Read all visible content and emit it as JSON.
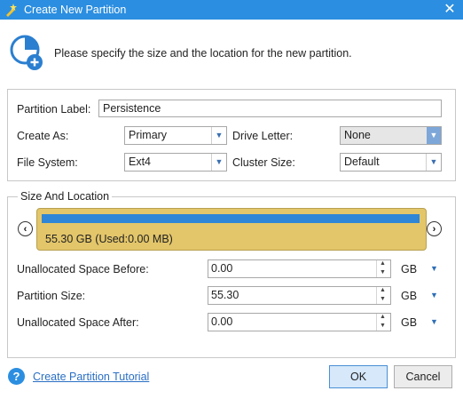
{
  "window": {
    "title": "Create New Partition",
    "close_glyph": "✕"
  },
  "header": {
    "instruction": "Please specify the size and the location for the new partition."
  },
  "form": {
    "partition_label": {
      "label": "Partition Label:",
      "value": "Persistence"
    },
    "create_as": {
      "label": "Create As:",
      "value": "Primary"
    },
    "drive_letter": {
      "label": "Drive Letter:",
      "value": "None"
    },
    "file_system": {
      "label": "File System:",
      "value": "Ext4"
    },
    "cluster_size": {
      "label": "Cluster Size:",
      "value": "Default"
    }
  },
  "size_location": {
    "title": "Size And Location",
    "disk_info": "55.30 GB (Used:0.00 MB)",
    "used_fraction": 1.0,
    "fields": [
      {
        "label": "Unallocated Space Before:",
        "value": "0.00",
        "unit": "GB"
      },
      {
        "label": "Partition Size:",
        "value": "55.30",
        "unit": "GB"
      },
      {
        "label": "Unallocated Space After:",
        "value": "0.00",
        "unit": "GB"
      }
    ]
  },
  "footer": {
    "help_glyph": "?",
    "tutorial_link": "Create Partition Tutorial",
    "ok_label": "OK",
    "cancel_label": "Cancel"
  },
  "colors": {
    "titlebar": "#2b8ee0",
    "disk_block": "#e3c66a",
    "disk_bar": "#2f86d6",
    "link": "#2a6fc4"
  },
  "icons": {
    "app": "partition-wand-icon",
    "header": "partition-add-icon",
    "help": "help-icon"
  }
}
